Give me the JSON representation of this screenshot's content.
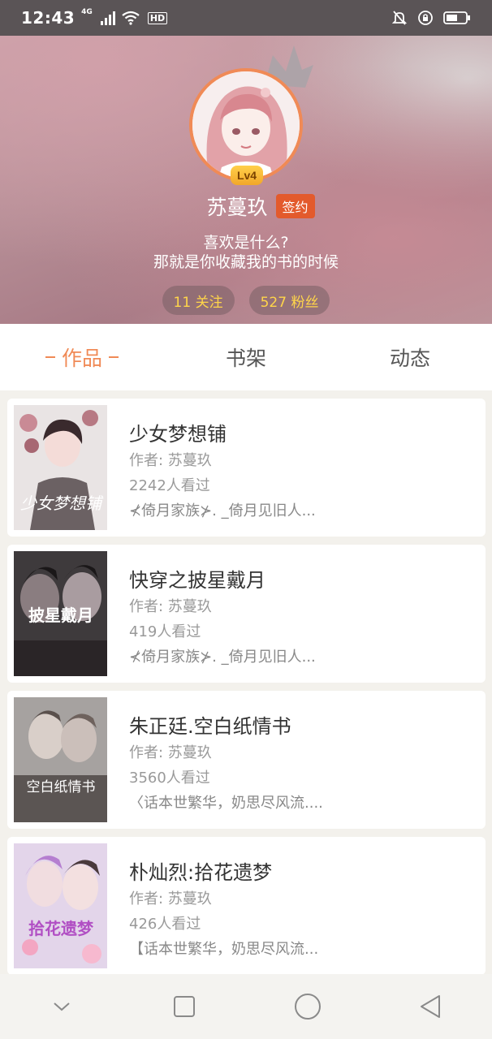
{
  "status_bar": {
    "time": "12:43",
    "network": "4G",
    "hd": "HD",
    "icons": [
      "signal-icon",
      "wifi-icon",
      "mute-icon",
      "alarm-icon",
      "battery-icon"
    ]
  },
  "profile": {
    "level": "Lv4",
    "name": "苏蔓玖",
    "sign_badge": "签约",
    "bio_line1": "喜欢是什么?",
    "bio_line2": "那就是你收藏我的书的时候",
    "following": "11 关注",
    "followers": "527 粉丝"
  },
  "tabs": [
    {
      "label": "作品",
      "active": true
    },
    {
      "label": "书架",
      "active": false
    },
    {
      "label": "动态",
      "active": false
    }
  ],
  "books": [
    {
      "title": "少女梦想铺",
      "author": "作者: 苏蔓玖",
      "views": "2242人看过",
      "group": "⊀倚月家族⊁. _倚月见旧人...",
      "cover_text": "少女梦想铺"
    },
    {
      "title": "快穿之披星戴月",
      "author": "作者: 苏蔓玖",
      "views": "419人看过",
      "group": "⊀倚月家族⊁. _倚月见旧人...",
      "cover_text": "披星戴月"
    },
    {
      "title": "朱正廷.空白纸情书",
      "author": "作者: 苏蔓玖",
      "views": "3560人看过",
      "group": "〈话本世繁华，奶思尽风流....",
      "cover_text": "空白纸情书"
    },
    {
      "title": "朴灿烈:拾花遗梦",
      "author": "作者: 苏蔓玖",
      "views": "426人看过",
      "group": "【话本世繁华，奶思尽风流...",
      "cover_text": "拾花遗梦"
    }
  ],
  "colors": {
    "accent": "#f08a56",
    "sign_badge": "#e35a2c",
    "stat_text": "#ffd54a"
  }
}
